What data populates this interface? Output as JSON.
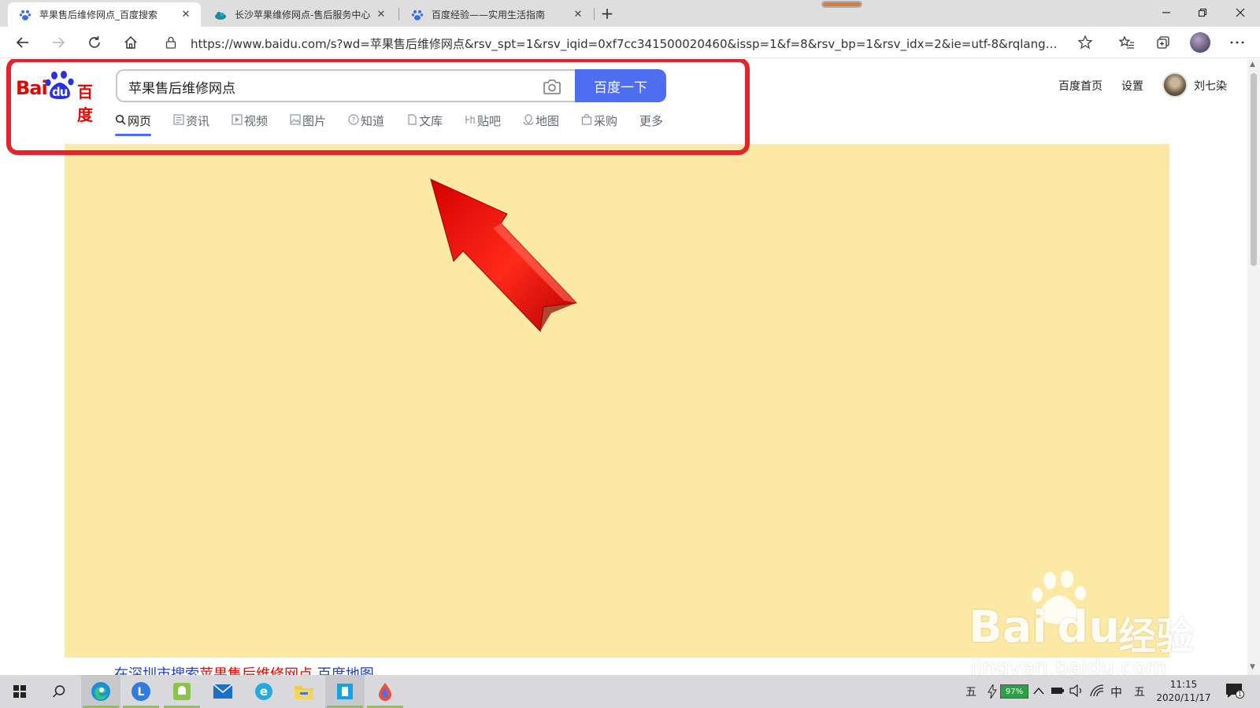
{
  "browser": {
    "tabs": [
      {
        "title": "苹果售后维修网点_百度搜索",
        "active": true,
        "icon": "baidu-paw-icon"
      },
      {
        "title": "长沙苹果维修网点-售后服务中心",
        "active": false,
        "icon": "cloud-icon"
      },
      {
        "title": "百度经验——实用生活指南",
        "active": false,
        "icon": "baidu-paw-icon"
      }
    ],
    "new_tab_label": "+",
    "url": "https://www.baidu.com/s?wd=苹果售后维修网点&rsv_spt=1&rsv_iqid=0xf7cc341500020460&issp=1&f=8&rsv_bp=1&rsv_idx=2&ie=utf-8&rqlang=c..."
  },
  "page": {
    "logo_text_left": "Bai",
    "logo_text_mid": "du",
    "logo_text_right": "百度",
    "search_value": "苹果售后维修网点",
    "search_button": "百度一下",
    "search_tabs": [
      {
        "label": "网页",
        "icon": "search-icon",
        "active": true
      },
      {
        "label": "资讯",
        "icon": "news-icon",
        "active": false
      },
      {
        "label": "视频",
        "icon": "video-icon",
        "active": false
      },
      {
        "label": "图片",
        "icon": "image-icon",
        "active": false
      },
      {
        "label": "知道",
        "icon": "question-icon",
        "active": false
      },
      {
        "label": "文库",
        "icon": "document-icon",
        "active": false
      },
      {
        "label": "贴吧",
        "icon": "tieba-icon",
        "active": false
      },
      {
        "label": "地图",
        "icon": "map-icon",
        "active": false
      },
      {
        "label": "采购",
        "icon": "shopping-icon",
        "active": false
      },
      {
        "label": "更多",
        "icon": "",
        "active": false
      }
    ],
    "top_links": {
      "home": "百度首页",
      "settings": "设置"
    },
    "username": "刘七染",
    "result_line": {
      "prefix": "在深圳市搜索",
      "keyword": "苹果售后维修网点",
      "suffix": " 百度地图"
    },
    "colors": {
      "brand_red": "#e10602",
      "brand_blue": "#4e6ef2",
      "highlight": "#e6232c",
      "ad_bg": "#fce9a6"
    }
  },
  "watermark": {
    "brand": "Bai",
    "brand2": "du",
    "cn": "经验",
    "site": "jingyan.baidu.com"
  },
  "taskbar": {
    "apps": [
      "windows-start-icon",
      "search-icon",
      "edge-icon",
      "app-l-icon",
      "android-icon",
      "mail-icon",
      "ie-icon",
      "folder-icon",
      "store-icon",
      "droplet-icon"
    ],
    "ime_left": "五",
    "battery": "97%",
    "ime_lang": "中",
    "ime_right": "五",
    "time": "11:15",
    "date": "2020/11/17",
    "notification_count": "1"
  }
}
